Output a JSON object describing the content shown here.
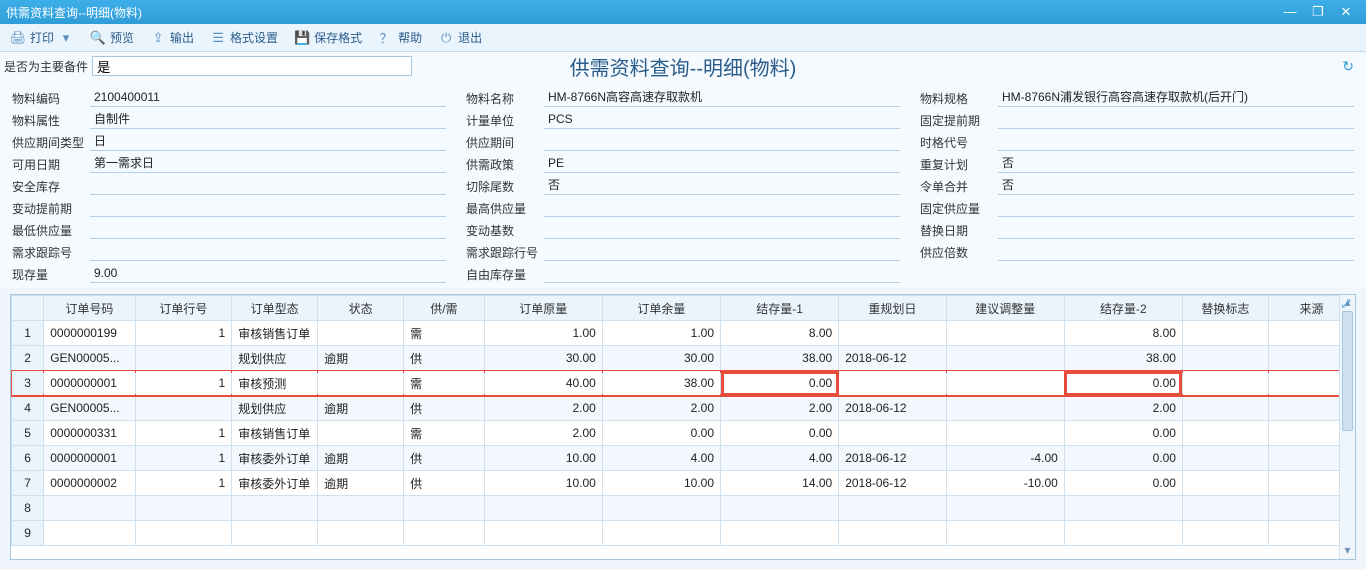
{
  "window": {
    "title": "供需资料查询--明细(物料)"
  },
  "toolbar": {
    "print": "打印",
    "preview": "预览",
    "export": "输出",
    "format": "格式设置",
    "saveFormat": "保存格式",
    "help": "帮助",
    "exit": "退出"
  },
  "filter": {
    "label": "是否为主要备件",
    "value": "是"
  },
  "pageTitle": "供需资料查询--明细(物料)",
  "info": {
    "col1": [
      {
        "k": "物料编码",
        "v": "2100400011"
      },
      {
        "k": "物料属性",
        "v": "自制件"
      },
      {
        "k": "供应期间类型",
        "v": "日"
      },
      {
        "k": "可用日期",
        "v": "第一需求日"
      },
      {
        "k": "安全库存",
        "v": ""
      },
      {
        "k": "变动提前期",
        "v": ""
      },
      {
        "k": "最低供应量",
        "v": ""
      },
      {
        "k": "需求跟踪号",
        "v": ""
      },
      {
        "k": "现存量",
        "v": "9.00"
      }
    ],
    "col2": [
      {
        "k": "物料名称",
        "v": "HM-8766N高容高速存取款机"
      },
      {
        "k": "计量单位",
        "v": "PCS"
      },
      {
        "k": "供应期间",
        "v": ""
      },
      {
        "k": "供需政策",
        "v": "PE"
      },
      {
        "k": "切除尾数",
        "v": "否"
      },
      {
        "k": "最高供应量",
        "v": ""
      },
      {
        "k": "变动基数",
        "v": ""
      },
      {
        "k": "需求跟踪行号",
        "v": ""
      },
      {
        "k": "自由库存量",
        "v": ""
      }
    ],
    "col3": [
      {
        "k": "物料规格",
        "v": "HM-8766N浦发银行高容高速存取款机(后开门)"
      },
      {
        "k": "固定提前期",
        "v": ""
      },
      {
        "k": "时格代号",
        "v": ""
      },
      {
        "k": "重复计划",
        "v": "否"
      },
      {
        "k": "令单合并",
        "v": "否"
      },
      {
        "k": "固定供应量",
        "v": ""
      },
      {
        "k": "替换日期",
        "v": ""
      },
      {
        "k": "供应倍数",
        "v": ""
      }
    ]
  },
  "grid": {
    "columns": [
      "订单号码",
      "订单行号",
      "订单型态",
      "状态",
      "供/需",
      "订单原量",
      "订单余量",
      "结存量-1",
      "重规划日",
      "建议调整量",
      "结存量-2",
      "替换标志",
      "来源"
    ],
    "widths": [
      85,
      90,
      80,
      80,
      75,
      110,
      110,
      110,
      100,
      110,
      110,
      80,
      80
    ],
    "rows": [
      {
        "n": "1",
        "c": [
          "0000000199",
          "1",
          "审核销售订单",
          "",
          "需",
          "1.00",
          "1.00",
          "8.00",
          "",
          "",
          "8.00",
          "",
          ""
        ]
      },
      {
        "n": "2",
        "c": [
          "GEN00005...",
          "",
          "规划供应",
          "逾期",
          "供",
          "30.00",
          "30.00",
          "38.00",
          "2018-06-12",
          "",
          "38.00",
          "",
          ""
        ]
      },
      {
        "n": "3",
        "c": [
          "0000000001",
          "1",
          "审核预测",
          "",
          "需",
          "40.00",
          "38.00",
          "0.00",
          "",
          "",
          "0.00",
          "",
          ""
        ],
        "hl": true,
        "boxCols": [
          7,
          10
        ]
      },
      {
        "n": "4",
        "c": [
          "GEN00005...",
          "",
          "规划供应",
          "逾期",
          "供",
          "2.00",
          "2.00",
          "2.00",
          "2018-06-12",
          "",
          "2.00",
          "",
          ""
        ]
      },
      {
        "n": "5",
        "c": [
          "0000000331",
          "1",
          "审核销售订单",
          "",
          "需",
          "2.00",
          "0.00",
          "0.00",
          "",
          "",
          "0.00",
          "",
          ""
        ]
      },
      {
        "n": "6",
        "c": [
          "0000000001",
          "1",
          "审核委外订单",
          "逾期",
          "供",
          "10.00",
          "4.00",
          "4.00",
          "2018-06-12",
          "-4.00",
          "0.00",
          "",
          ""
        ]
      },
      {
        "n": "7",
        "c": [
          "0000000002",
          "1",
          "审核委外订单",
          "逾期",
          "供",
          "10.00",
          "10.00",
          "14.00",
          "2018-06-12",
          "-10.00",
          "0.00",
          "",
          ""
        ]
      },
      {
        "n": "8",
        "c": [
          "",
          "",
          "",
          "",
          "",
          "",
          "",
          "",
          "",
          "",
          "",
          "",
          ""
        ]
      },
      {
        "n": "9",
        "c": [
          "",
          "",
          "",
          "",
          "",
          "",
          "",
          "",
          "",
          "",
          "",
          "",
          ""
        ]
      }
    ],
    "numericCols": [
      1,
      5,
      6,
      7,
      9,
      10
    ]
  }
}
